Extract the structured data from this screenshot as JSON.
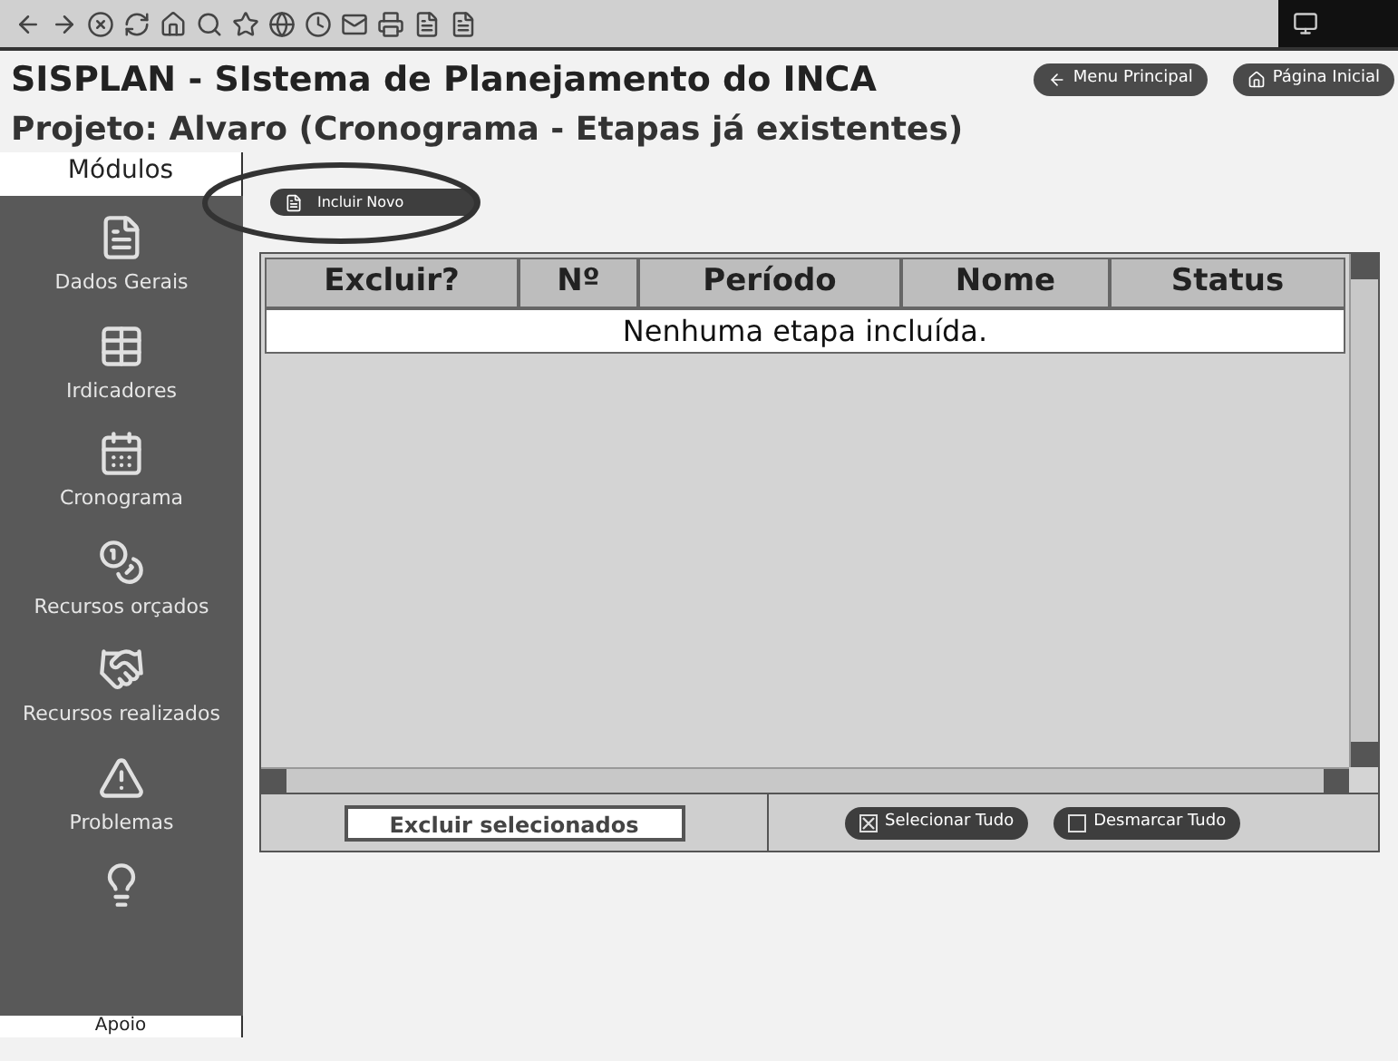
{
  "header": {
    "title": "SISPLAN - SIstema de Planejamento do INCA",
    "project": "Projeto: Alvaro (Cronograma - Etapas já existentes)",
    "nav_buttons": [
      {
        "label": "Menu Principal",
        "kind": "back"
      },
      {
        "label": "Página Inicial",
        "kind": "home"
      }
    ]
  },
  "sidebar": {
    "title": "Módulos",
    "items": [
      {
        "label": "Dados Gerais",
        "kind": "document"
      },
      {
        "label": "Irdicadores",
        "kind": "chart"
      },
      {
        "label": "Cronograma",
        "kind": "calendar"
      },
      {
        "label": "Recursos orçados",
        "kind": "coins"
      },
      {
        "label": "Recursos realizados",
        "kind": "hands"
      },
      {
        "label": "Problemas",
        "kind": "warning"
      },
      {
        "kind": "idea"
      }
    ],
    "footer": "Apoio"
  },
  "add_button": {
    "label": "Incluir Novo"
  },
  "table": {
    "columns": [
      "Excluir?",
      "Nº",
      "Período",
      "Nome",
      "Status"
    ],
    "empty_message": "Nenhuma etapa incluída."
  },
  "footer": {
    "delete_button": "Excluir selecionados",
    "select_buttons": [
      {
        "label": "Selecionar Tudo",
        "checked": true
      },
      {
        "label": "Desmarcar Tudo",
        "checked": false
      }
    ]
  }
}
